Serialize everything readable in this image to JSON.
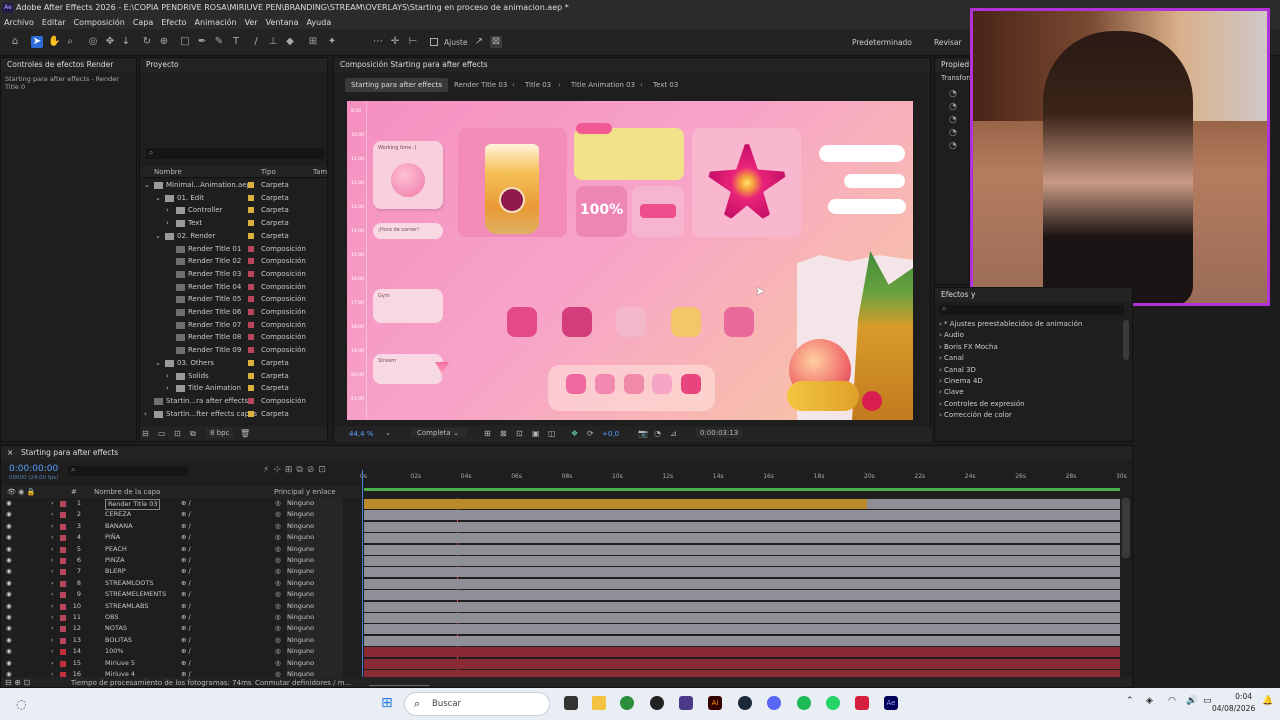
{
  "titlebar": {
    "text": "Adobe After Effects 2026 - E:\\COPIA PENDRIVE ROSA\\MIRIUVE PEN\\BRANDING\\STREAM\\OVERLAYS\\Starting en proceso de animacion.aep *",
    "icon": "Ae"
  },
  "menu": [
    "Archivo",
    "Editar",
    "Composición",
    "Capa",
    "Efecto",
    "Animación",
    "Ver",
    "Ventana",
    "Ayuda"
  ],
  "toolbar": {
    "snap_label": "Ajuste",
    "workspace": "Predeterminado",
    "review": "Revisar"
  },
  "effects_panel": {
    "title": "Controles de efectos Render",
    "subtitle": "Starting para after effects - Render Title 0"
  },
  "project_panel": {
    "title": "Proyecto",
    "col_name": "Nombre",
    "col_type": "Tipo",
    "col_size": "Tama",
    "items": [
      {
        "indent": 0,
        "arrow": "v",
        "name": "Minimal...Animation.aep",
        "type": "Carpeta",
        "color": "#d9b13c"
      },
      {
        "indent": 1,
        "arrow": "v",
        "name": "01. Edit",
        "type": "Carpeta",
        "color": "#d9b13c"
      },
      {
        "indent": 2,
        "arrow": ">",
        "name": "Controller",
        "type": "Carpeta",
        "color": "#d9b13c"
      },
      {
        "indent": 2,
        "arrow": ">",
        "name": "Text",
        "type": "Carpeta",
        "color": "#d9b13c"
      },
      {
        "indent": 1,
        "arrow": "v",
        "name": "02. Render",
        "type": "Carpeta",
        "color": "#d9b13c"
      },
      {
        "indent": 2,
        "arrow": "",
        "name": "Render Title 01",
        "type": "Composición",
        "color": "#b8455c"
      },
      {
        "indent": 2,
        "arrow": "",
        "name": "Render Title 02",
        "type": "Composición",
        "color": "#b8455c"
      },
      {
        "indent": 2,
        "arrow": "",
        "name": "Render Title 03",
        "type": "Composición",
        "color": "#b8455c"
      },
      {
        "indent": 2,
        "arrow": "",
        "name": "Render Title 04",
        "type": "Composición",
        "color": "#b8455c"
      },
      {
        "indent": 2,
        "arrow": "",
        "name": "Render Title 05",
        "type": "Composición",
        "color": "#b8455c"
      },
      {
        "indent": 2,
        "arrow": "",
        "name": "Render Title 06",
        "type": "Composición",
        "color": "#b8455c"
      },
      {
        "indent": 2,
        "arrow": "",
        "name": "Render Title 07",
        "type": "Composición",
        "color": "#b8455c"
      },
      {
        "indent": 2,
        "arrow": "",
        "name": "Render Title 08",
        "type": "Composición",
        "color": "#b8455c"
      },
      {
        "indent": 2,
        "arrow": "",
        "name": "Render Title 09",
        "type": "Composición",
        "color": "#b8455c"
      },
      {
        "indent": 1,
        "arrow": "v",
        "name": "03. Others",
        "type": "Carpeta",
        "color": "#d9b13c"
      },
      {
        "indent": 2,
        "arrow": ">",
        "name": "Solids",
        "type": "Carpeta",
        "color": "#d9b13c"
      },
      {
        "indent": 2,
        "arrow": ">",
        "name": "Title Animation",
        "type": "Carpeta",
        "color": "#d9b13c"
      },
      {
        "indent": 0,
        "arrow": "",
        "name": "Startin...ra after effects",
        "type": "Composición",
        "color": "#b8455c"
      },
      {
        "indent": 0,
        "arrow": ">",
        "name": "Startin...fter effects capas",
        "type": "Carpeta",
        "color": "#d9b13c"
      }
    ],
    "bpc": "8 bpc"
  },
  "comp_panel": {
    "title": "Composición Starting para after effects",
    "tabs": [
      "Starting para after effects",
      "Render Title 03",
      "Title 03",
      "Title Animation 03",
      "Text 03"
    ],
    "zoom": "44,4 %",
    "quality": "Completa",
    "exposure": "+0,0",
    "time": "0:00:03:13"
  },
  "canvas": {
    "percent": "100%",
    "note1": "Working time :)",
    "note2": "¡Hora de comer!",
    "note3": "Gym",
    "note4": "Stream",
    "times": [
      "8:30",
      "10:00",
      "11:00",
      "12:00",
      "13:00",
      "14:00",
      "15:00",
      "16:00",
      "17:00",
      "18:00",
      "19:00",
      "20:00",
      "21:00"
    ]
  },
  "props_panel": {
    "title": "Propied",
    "sub": "Transform"
  },
  "effects_presets": {
    "title": "Efectos y",
    "items": [
      "* Ajustes preestablecidos de animación",
      "Audio",
      "Boris FX Mocha",
      "Canal",
      "Canal 3D",
      "Cinema 4D",
      "Clave",
      "Controles de expresión",
      "Corrección de color"
    ]
  },
  "timeline": {
    "comp_tab": "Starting para after effects",
    "timecode": "0:00:00:00",
    "fps": "00000 (24.00 fps)",
    "col_layer": "Nombre de la capa",
    "col_parent": "Principal y enlace",
    "ruler": [
      "0s",
      "02s",
      "04s",
      "06s",
      "08s",
      "10s",
      "12s",
      "14s",
      "16s",
      "18s",
      "20s",
      "22s",
      "24s",
      "26s",
      "28s",
      "30s"
    ],
    "layers": [
      {
        "num": "1",
        "name": "Render Title 03",
        "parent": "Ninguno",
        "color": "#b8455c"
      },
      {
        "num": "2",
        "name": "CEREZA",
        "parent": "Ninguno",
        "color": "#b8455c"
      },
      {
        "num": "3",
        "name": "BANANA",
        "parent": "Ninguno",
        "color": "#b8455c"
      },
      {
        "num": "4",
        "name": "PIÑA",
        "parent": "Ninguno",
        "color": "#b8455c"
      },
      {
        "num": "5",
        "name": "PEACH",
        "parent": "Ninguno",
        "color": "#b8455c"
      },
      {
        "num": "6",
        "name": "PINZA",
        "parent": "Ninguno",
        "color": "#b8455c"
      },
      {
        "num": "7",
        "name": "BLERP",
        "parent": "Ninguno",
        "color": "#b8455c"
      },
      {
        "num": "8",
        "name": "STREAMLOOTS",
        "parent": "Ninguno",
        "color": "#b8455c"
      },
      {
        "num": "9",
        "name": "STREAMELEMENTS",
        "parent": "Ninguno",
        "color": "#b8455c"
      },
      {
        "num": "10",
        "name": "STREAMLABS",
        "parent": "Ninguno",
        "color": "#b8455c"
      },
      {
        "num": "11",
        "name": "OBS",
        "parent": "Ninguno",
        "color": "#b8455c"
      },
      {
        "num": "12",
        "name": "NOTAS",
        "parent": "Ninguno",
        "color": "#b8455c"
      },
      {
        "num": "13",
        "name": "BOLITAS",
        "parent": "Ninguno",
        "color": "#b8455c"
      },
      {
        "num": "14",
        "name": "100%",
        "parent": "Ninguno",
        "color": "#c02f3a"
      },
      {
        "num": "15",
        "name": "Miriuve 5",
        "parent": "Ninguno",
        "color": "#c02f3a"
      },
      {
        "num": "16",
        "name": "Miriuve 4",
        "parent": "Ninguno",
        "color": "#c02f3a"
      }
    ],
    "footer_left": "Tiempo de procesamiento de los fotogramas: 74ms",
    "footer_mid": "Conmutar definidores / m..."
  },
  "taskbar": {
    "search": "Buscar",
    "time": "0:04",
    "date": "04/08/2026"
  }
}
